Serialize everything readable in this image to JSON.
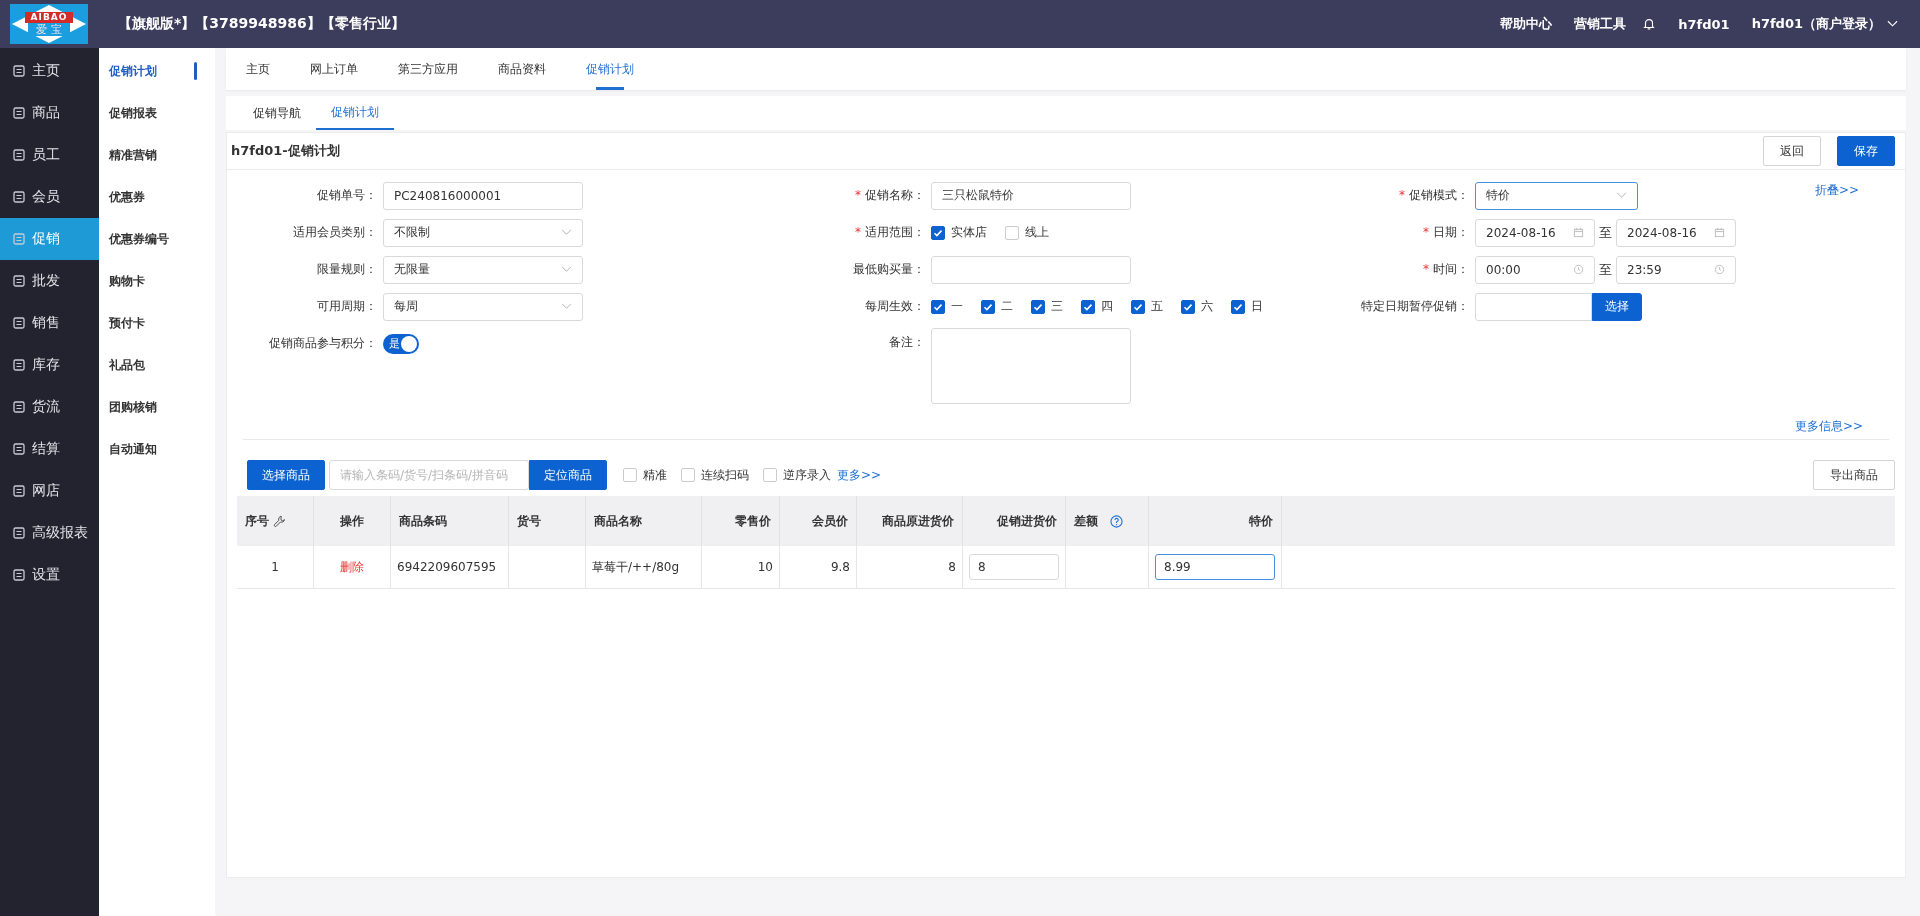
{
  "header": {
    "logo_top": "AIBAO",
    "logo_bottom": "爱 宝",
    "title": "【旗舰版*】【3789948986】【零售行业】",
    "links": [
      "帮助中心",
      "营销工具"
    ],
    "user": "h7fd01",
    "account": "h7fd01（商户登录）"
  },
  "nav": [
    {
      "label": "主页",
      "selected": false
    },
    {
      "label": "商品",
      "selected": false
    },
    {
      "label": "员工",
      "selected": false
    },
    {
      "label": "会员",
      "selected": false
    },
    {
      "label": "促销",
      "selected": true
    },
    {
      "label": "批发",
      "selected": false
    },
    {
      "label": "销售",
      "selected": false
    },
    {
      "label": "库存",
      "selected": false
    },
    {
      "label": "货流",
      "selected": false
    },
    {
      "label": "结算",
      "selected": false
    },
    {
      "label": "网店",
      "selected": false
    },
    {
      "label": "高级报表",
      "selected": false
    },
    {
      "label": "设置",
      "selected": false
    }
  ],
  "subnav": [
    {
      "label": "促销计划",
      "selected": true
    },
    {
      "label": "促销报表",
      "selected": false
    },
    {
      "label": "精准营销",
      "selected": false
    },
    {
      "label": "优惠券",
      "selected": false
    },
    {
      "label": "优惠券编号",
      "selected": false
    },
    {
      "label": "购物卡",
      "selected": false
    },
    {
      "label": "预付卡",
      "selected": false
    },
    {
      "label": "礼品包",
      "selected": false
    },
    {
      "label": "团购核销",
      "selected": false
    },
    {
      "label": "自动通知",
      "selected": false
    }
  ],
  "tabs": [
    {
      "label": "主页",
      "selected": false
    },
    {
      "label": "网上订单",
      "selected": false
    },
    {
      "label": "第三方应用",
      "selected": false
    },
    {
      "label": "商品资料",
      "selected": false
    },
    {
      "label": "促销计划",
      "selected": true
    }
  ],
  "subtabs": [
    {
      "label": "促销导航",
      "selected": false
    },
    {
      "label": "促销计划",
      "selected": true
    }
  ],
  "page_title": "h7fd01-促销计划",
  "buttons": {
    "back": "返回",
    "save": "保存"
  },
  "form": {
    "columns": [
      [
        {
          "label": "促销单号：",
          "kind": "text",
          "value": "PC240816000001"
        },
        {
          "label": "适用会员类别：",
          "kind": "select",
          "value": "不限制",
          "focused": false
        },
        {
          "label": "限量规则：",
          "kind": "select",
          "value": "无限量",
          "focused": false
        },
        {
          "label": "可用周期：",
          "kind": "select",
          "value": "每周",
          "focused": false
        },
        {
          "label": "促销商品参与积分：",
          "kind": "toggle",
          "on": true,
          "text": "是"
        }
      ],
      [
        {
          "mark": "*",
          "label": "促销名称：",
          "kind": "text",
          "value": "三只松鼠特价"
        },
        {
          "mark": "*",
          "label": "适用范围：",
          "kind": "checks",
          "items": [
            {
              "label": "实体店",
              "checked": true
            },
            {
              "label": "线上",
              "checked": false
            }
          ]
        },
        {
          "label": "最低购买量：",
          "kind": "text"
        },
        {
          "label": "每周生效：",
          "kind": "checks",
          "items": [
            {
              "label": "一",
              "checked": true
            },
            {
              "label": "二",
              "checked": true
            },
            {
              "label": "三",
              "checked": true
            },
            {
              "label": "四",
              "checked": true
            },
            {
              "label": "五",
              "checked": true
            },
            {
              "label": "六",
              "checked": true
            },
            {
              "label": "日",
              "checked": true
            }
          ]
        },
        {
          "label": "备注：",
          "kind": "textarea"
        }
      ],
      [
        {
          "mark": "*",
          "label": "促销模式：",
          "kind": "select",
          "value": "特价",
          "focused": true
        },
        {
          "mark": "*",
          "label": "日期：",
          "kind": "daterange",
          "from": "2024-08-16",
          "sep": "至",
          "to": "2024-08-16"
        },
        {
          "mark": "*",
          "label": "时间：",
          "kind": "timerange",
          "from": "00:00",
          "sep": "至",
          "to": "23:59"
        },
        {
          "label": "特定日期暂停促销：",
          "kind": "picker",
          "button": "选择"
        }
      ]
    ],
    "fold": "折叠>>",
    "more_info": "更多信息>>"
  },
  "toolbar": {
    "select": "选择商品",
    "search_placeholder": "请输入条码/货号/扫条码/拼音码",
    "locate": "定位商品",
    "options": [
      {
        "label": "精准",
        "checked": false
      },
      {
        "label": "连续扫码",
        "checked": false
      },
      {
        "label": "逆序录入",
        "checked": false
      }
    ],
    "more": "更多>>",
    "export": "导出商品"
  },
  "table": {
    "columns": [
      "序号",
      "操作",
      "商品条码",
      "货号",
      "商品名称",
      "零售价",
      "会员价",
      "商品原进货价",
      "促销进货价",
      "差额",
      "特价"
    ],
    "rows": [
      {
        "cells": [
          {
            "kind": "text",
            "text": "1"
          },
          {
            "kind": "delete",
            "text": "删除"
          },
          {
            "kind": "text",
            "text": "6942209607595"
          },
          {
            "kind": "text",
            "text": ""
          },
          {
            "kind": "text",
            "text": "草莓干/++/80g"
          },
          {
            "kind": "text",
            "text": "10"
          },
          {
            "kind": "text",
            "text": "9.8"
          },
          {
            "kind": "text",
            "text": "8"
          },
          {
            "kind": "input",
            "text": "8",
            "focused": false
          },
          {
            "kind": "text",
            "text": ""
          },
          {
            "kind": "input",
            "text": "8.99",
            "focused": true
          }
        ]
      }
    ]
  }
}
